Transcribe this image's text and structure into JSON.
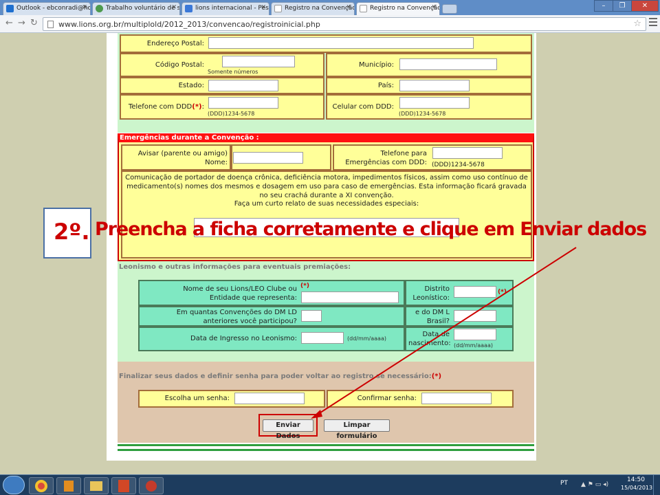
{
  "browser": {
    "tabs": [
      {
        "label": "Outlook - ebconradi@hot",
        "active": false
      },
      {
        "label": "Trabalho voluntário de se",
        "active": false
      },
      {
        "label": "lions internacional - Pesq",
        "active": false
      },
      {
        "label": "Registro na Convenção DI",
        "active": false
      },
      {
        "label": "Registro na Convenção DI",
        "active": true
      }
    ],
    "url": "www.lions.org.br/multiplold/2012_2013/convencao/registroinicial.php"
  },
  "address": {
    "endereco_label": "Endereço Postal:",
    "cep_label": "Código Postal:",
    "cep_hint": "Somente números",
    "municipio_label": "Município:",
    "estado_label": "Estado:",
    "pais_label": "País:",
    "telefone_label": "Telefone com DDD",
    "telefone_req": "(*)",
    "telefone_suffix": ":",
    "telefone_hint": "(DDD)1234-5678",
    "celular_label": "Celular com DDD:",
    "celular_hint": "(DDD)1234-5678"
  },
  "emergency": {
    "heading": "Emergências durante a Convenção :",
    "avisar_label_1": "Avisar (parente ou amigo)",
    "avisar_label_2": "Nome:",
    "tel_label_1": "Telefone para",
    "tel_label_2": "Emergências com DDD:",
    "tel_hint": "(DDD)1234-5678",
    "communication_text": "Comunicação de portador de doença crônica, deficiência motora, impedimentos físicos, assim como uso contínuo de medicamento(s) nomes dos mesmos e dosagem em uso para caso de emergências. Esta informação ficará gravada no seu crachá durante a XI convenção.",
    "relato_label": "Faça um curto relato de suas necessidades especiais:"
  },
  "annotation": {
    "number": "2º.",
    "text": "Preencha a ficha corretamente e clique em Enviar dados"
  },
  "lionism": {
    "heading": "Leonismo e outras informações para eventuais premiações:",
    "clube_label_1": "Nome de seu Lions/LEO Clube ou",
    "clube_label_2": "Entidade que representa:",
    "clube_req": "(*)",
    "distrito_label_1": "Distrito",
    "distrito_label_2": "Leonístico:",
    "distrito_req": "(*)",
    "convencoes_label_1": "Em quantas Convenções do DM LD",
    "convencoes_label_2": "anteriores você participou?",
    "dml_label_1": "e do DM L",
    "dml_label_2": "Brasil?",
    "ingresso_label": "Data de Ingresso no Leonismo:",
    "ingresso_hint": "(dd/mm/aaaa)",
    "nascimento_label_1": "Data de",
    "nascimento_label_2": "nascimento:",
    "nascimento_hint": "(dd/mm/aaaa)"
  },
  "finalize": {
    "heading": "Finalizar seus dados e definir senha para poder voltar ao registro se necessário:",
    "heading_req": "(*)",
    "senha_label": "Escolha um senha:",
    "confirmar_label": "Confirmar senha:",
    "enviar_label": "Enviar Dados",
    "limpar_label": "Limpar formulário"
  },
  "taskbar": {
    "lang": "PT",
    "time": "14:50",
    "date": "15/04/2013"
  },
  "colors": {
    "accent_red": "#cc0000",
    "form_yellow": "#ffff99",
    "form_green": "#ccf5cc",
    "form_teal": "#7fe8c2",
    "form_tan": "#dfc6ad"
  }
}
